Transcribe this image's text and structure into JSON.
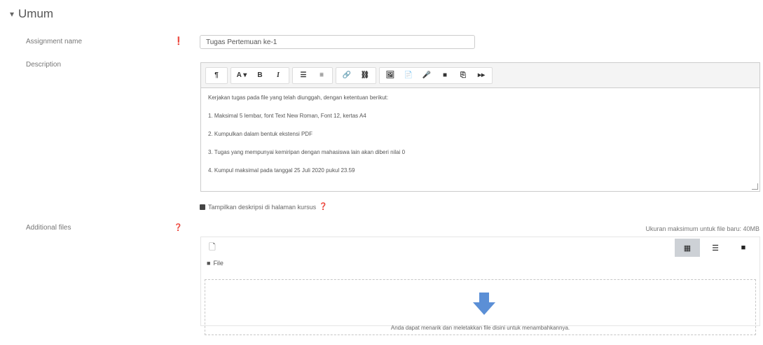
{
  "section": {
    "title": "Umum"
  },
  "assignment": {
    "label": "Assignment name",
    "value": "Tugas Pertemuan ke-1"
  },
  "description": {
    "label": "Description",
    "toolbar": {
      "para": "¶",
      "font": "A ▾",
      "bold": "B",
      "italic": "I",
      "ul": "☰",
      "ol": "≡",
      "link": "🔗",
      "unlink": "⛓",
      "image": "🖼",
      "file": "📄",
      "record_audio": "🎤",
      "record_video": "■",
      "copy": "⎘",
      "more": "▸▸"
    },
    "lines": [
      "Kerjakan tugas pada file yang telah diunggah, dengan ketentuan berikut:",
      "1. Maksimal 5 lembar, font Text New Roman, Font 12, kertas A4",
      "2. Kumpulkan dalam bentuk ekstensi PDF",
      "3. Tugas yang mempunyai kemiripan dengan mahasiswa lain akan diberi nilai 0",
      "4. Kumpul maksimal pada tanggal 25 Juli 2020 pukul 23.59"
    ]
  },
  "show_description": {
    "label": "Tampilkan deskripsi di halaman kursus"
  },
  "additional_files": {
    "label": "Additional files",
    "max_size": "Ukuran maksimum untuk file baru: 40MB",
    "path_label": "File",
    "drop_text": "Anda dapat menarik dan meletakkan file disini untuk menambahkannya."
  },
  "colors": {
    "required": "#c0392b",
    "help": "#1f8ec1",
    "link_underline": "#8b2323",
    "drop_arrow": "#5b8fd6"
  }
}
